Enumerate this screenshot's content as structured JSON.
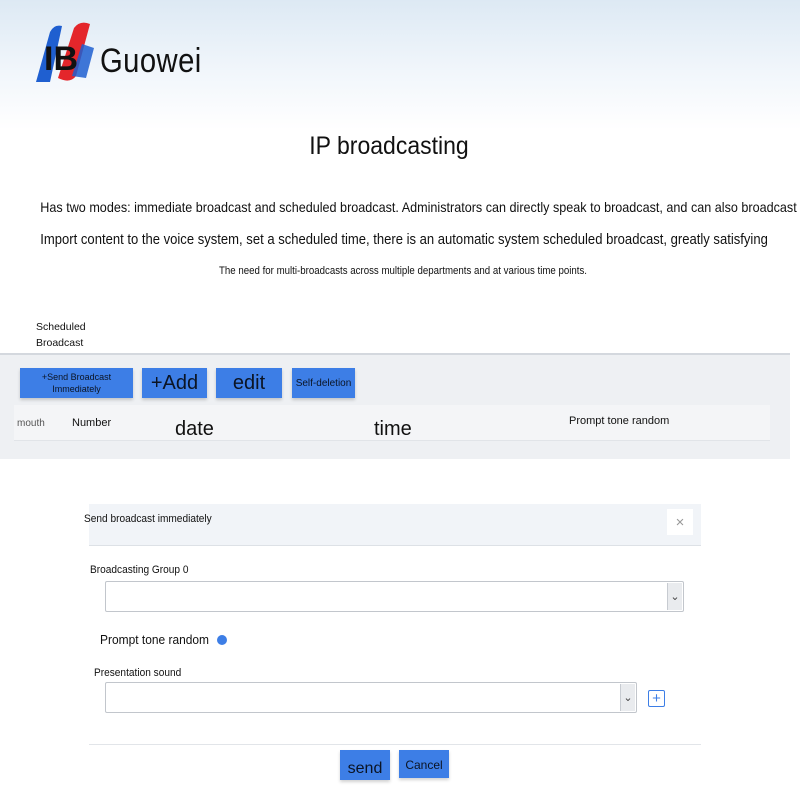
{
  "brand": {
    "name": "Guowei"
  },
  "title": "IP broadcasting",
  "description": [
    "Has two modes: immediate broadcast and scheduled broadcast. Administrators can directly speak to broadcast, and can also broadcast",
    "Import content to the voice system, set a scheduled time, there is an automatic system scheduled broadcast, greatly satisfying",
    "The need for multi-broadcasts across multiple departments and at various time points."
  ],
  "scheduled": {
    "tab_label": "Scheduled Broadcast",
    "toolbar": {
      "send_now": "+Send Broadcast Immediately",
      "add": "+Add",
      "edit": "edit",
      "self_delete": "Self-deletion"
    },
    "table_headers": [
      "mouth",
      "Number",
      "date",
      "time",
      "Prompt tone random"
    ]
  },
  "dialog": {
    "title": "Send broadcast immediately",
    "close_symbol": "×",
    "group_label": "Broadcasting Group 0",
    "group_value": "",
    "prompt_toggle_label": "Prompt tone random",
    "sound_label": "Presentation sound",
    "sound_value": "",
    "add_symbol": "+",
    "send_label": "send",
    "cancel_label": "Cancel"
  },
  "colors": {
    "accent": "#3d7ee6",
    "panel": "#eef0f3",
    "header": "#f1f4f8"
  }
}
